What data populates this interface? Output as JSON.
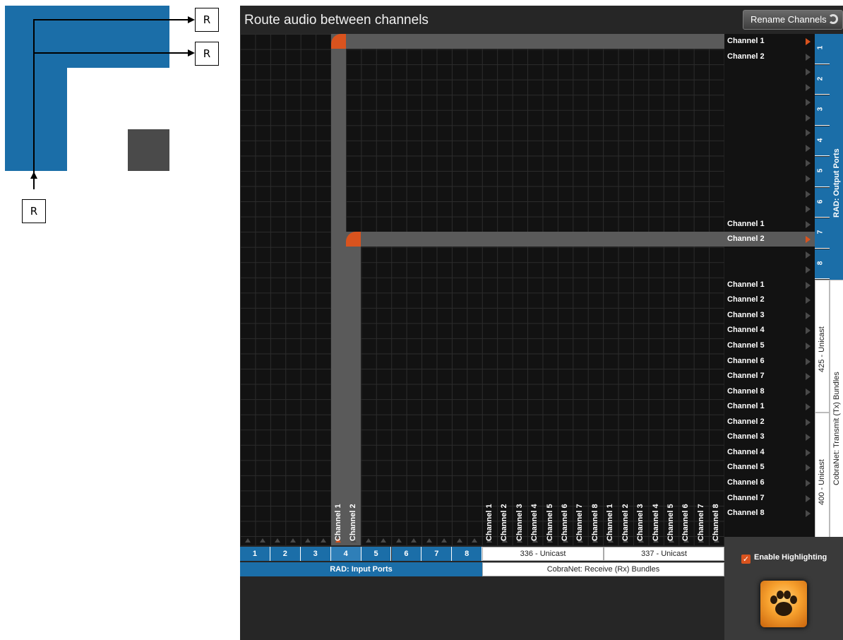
{
  "schematic": {
    "labels": [
      "R",
      "R",
      "R"
    ]
  },
  "window": {
    "title": "Route audio between channels"
  },
  "toolbar": {
    "rename_label": "Rename Channels",
    "rename_icon": "refresh-icon"
  },
  "outputs": {
    "group_label": "RAD: Output Ports",
    "ports": [
      "1",
      "2",
      "3",
      "4",
      "5",
      "6",
      "7",
      "8"
    ],
    "rows": [
      {
        "label": "Channel 1",
        "routed": true
      },
      {
        "label": "Channel 2",
        "routed": false
      },
      {
        "label": "",
        "routed": false
      },
      {
        "label": "",
        "routed": false
      },
      {
        "label": "",
        "routed": false
      },
      {
        "label": "",
        "routed": false
      },
      {
        "label": "",
        "routed": false
      },
      {
        "label": "",
        "routed": false
      },
      {
        "label": "",
        "routed": false
      },
      {
        "label": "",
        "routed": false
      },
      {
        "label": "",
        "routed": false
      },
      {
        "label": "",
        "routed": false
      },
      {
        "label": "Channel 1",
        "routed": false
      },
      {
        "label": "Channel 2",
        "routed": true,
        "selected": true
      },
      {
        "label": "",
        "routed": false
      },
      {
        "label": "",
        "routed": false
      }
    ]
  },
  "tx": {
    "group_label": "CobraNet: Transmit (Tx) Bundles",
    "bundles": [
      {
        "label": "425 - Unicast",
        "channels": [
          "Channel 1",
          "Channel 2",
          "Channel 3",
          "Channel 4",
          "Channel 5",
          "Channel 6",
          "Channel 7",
          "Channel 8"
        ]
      },
      {
        "label": "400 - Unicast",
        "channels": [
          "Channel 1",
          "Channel 2",
          "Channel 3",
          "Channel 4",
          "Channel 5",
          "Channel 6",
          "Channel 7",
          "Channel 8"
        ]
      }
    ]
  },
  "inputs": {
    "group_label": "RAD: Input Ports",
    "ports": [
      "1",
      "2",
      "3",
      "4",
      "5",
      "6",
      "7",
      "8"
    ],
    "selected_port": "4",
    "channel_labels": [
      "Channel 1",
      "Channel 2"
    ]
  },
  "rx": {
    "group_label": "CobraNet: Receive (Rx) Bundles",
    "bundles": [
      {
        "label": "336 - Unicast",
        "channels": [
          "Channel 1",
          "Channel 2",
          "Channel 3",
          "Channel 4",
          "Channel 5",
          "Channel 6",
          "Channel 7",
          "Channel 8"
        ]
      },
      {
        "label": "337 - Unicast",
        "channels": [
          "Channel 1",
          "Channel 2",
          "Channel 3",
          "Channel 4",
          "Channel 5",
          "Channel 6",
          "Channel 7",
          "Channel 8"
        ]
      }
    ]
  },
  "options": {
    "highlight_label": "Enable Highlighting",
    "highlight_checked": true,
    "logo_icon": "paw-icon"
  },
  "colors": {
    "accent": "#d9531e",
    "rad_blue": "#1b6ea8",
    "grid_bg": "#121212",
    "highlight": "#5a5a5a"
  }
}
